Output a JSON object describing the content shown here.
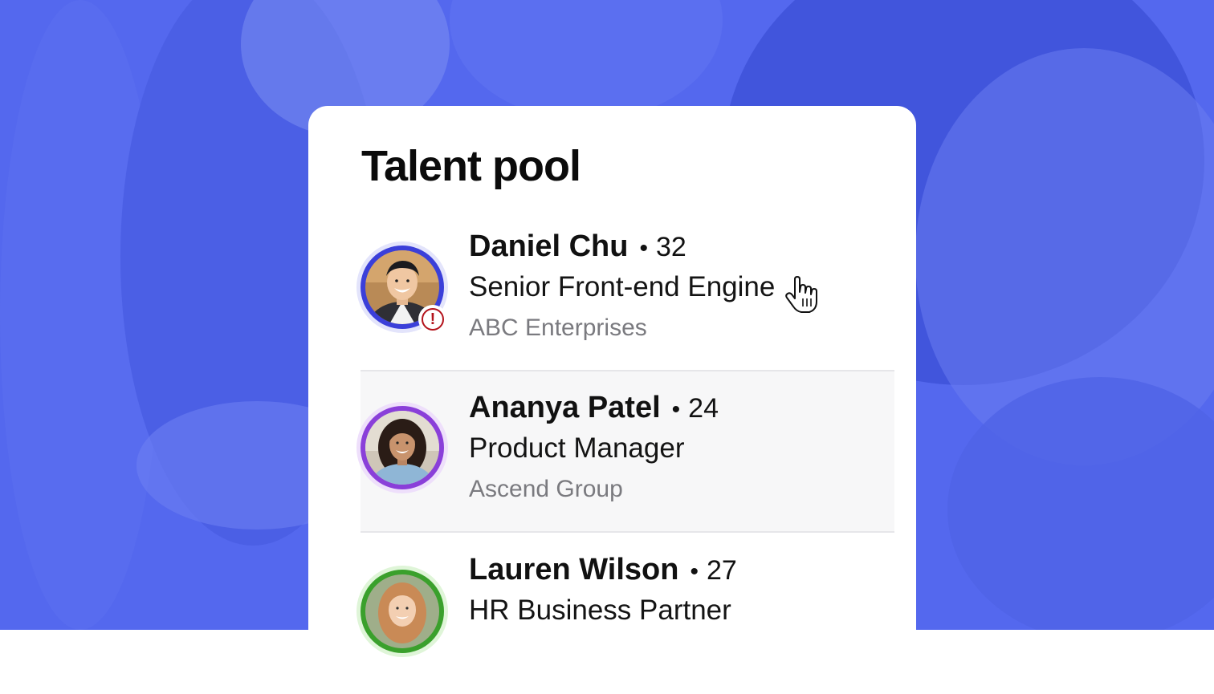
{
  "page": {
    "title": "Talent pool"
  },
  "candidates": [
    {
      "name": "Daniel Chu",
      "separator": "•",
      "age": "32",
      "role": "Senior Front-end Engine",
      "company": "ABC Enterprises",
      "ring_color": "#3b3fd9",
      "ring_glow": "#e3e4fb",
      "has_alert": true,
      "alert_color": "#b3121b"
    },
    {
      "name": "Ananya Patel",
      "separator": "•",
      "age": "24",
      "role": "Product Manager",
      "company": "Ascend Group",
      "ring_color": "#8a3fd9",
      "ring_glow": "#eedffb",
      "has_alert": false
    },
    {
      "name": "Lauren Wilson",
      "separator": "•",
      "age": "27",
      "role": "HR Business Partner",
      "company": "",
      "ring_color": "#3aa02c",
      "ring_glow": "#dff5d8",
      "has_alert": false
    }
  ],
  "icons": {
    "alert": "exclamation-circle-icon",
    "cursor": "hand-pointer-icon"
  },
  "colors": {
    "background": "#5468ee",
    "card": "#ffffff",
    "selected_row": "#f7f7f8"
  }
}
